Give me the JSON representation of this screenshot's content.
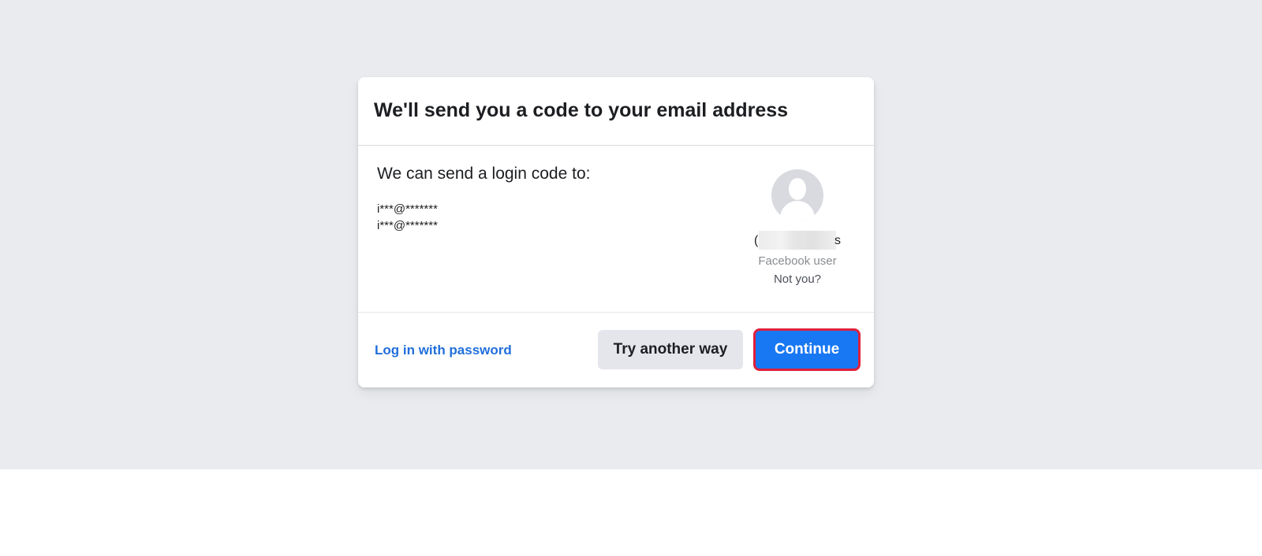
{
  "card": {
    "title": "We'll send you a code to your email address",
    "send_label": "We can send a login code to:",
    "contacts": [
      "i***@*******",
      "i***@*******"
    ],
    "profile": {
      "name_edge_left": "(",
      "name_edge_right": "s",
      "subtitle": "Facebook user",
      "not_you": "Not you?"
    },
    "footer": {
      "login_with_password": "Log in with password",
      "try_another_way": "Try another way",
      "continue": "Continue"
    }
  },
  "colors": {
    "primary": "#1877f2",
    "link": "#216fdb",
    "highlight_border": "#e0203b",
    "backdrop": "#e9ebee"
  }
}
